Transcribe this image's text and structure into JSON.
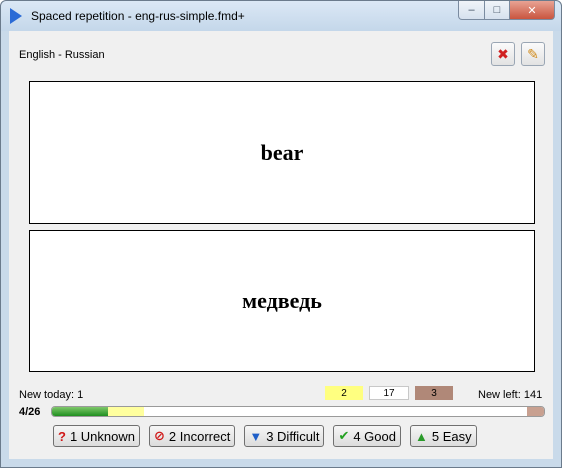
{
  "window": {
    "title": "Spaced repetition - eng-rus-simple.fmd+",
    "minimize_glyph": "–",
    "maximize_glyph": "□",
    "close_glyph": "✕"
  },
  "deck": {
    "name": "English - Russian"
  },
  "toolbar": {
    "delete_icon": "✖",
    "edit_icon": "✎"
  },
  "card": {
    "front": "bear",
    "back": "медведь"
  },
  "stats": {
    "new_today": "New today: 1",
    "count_yellow": "2",
    "count_white": "17",
    "count_brown": "3",
    "new_left": "New left: 141",
    "progress_label": "4/26",
    "progress": {
      "done": 4,
      "total": 26,
      "yellow": 2,
      "brown": 3
    },
    "colors": {
      "yellow": "#ffff80",
      "brown": "#b08878",
      "green": "#1f8f1f"
    }
  },
  "answers": [
    {
      "icon": "?",
      "label": "1 Unknown"
    },
    {
      "icon": "⊘",
      "label": "2 Incorrect"
    },
    {
      "icon": "▼",
      "label": "3 Difficult"
    },
    {
      "icon": "✔",
      "label": "4 Good"
    },
    {
      "icon": "▲",
      "label": "5 Easy"
    }
  ]
}
